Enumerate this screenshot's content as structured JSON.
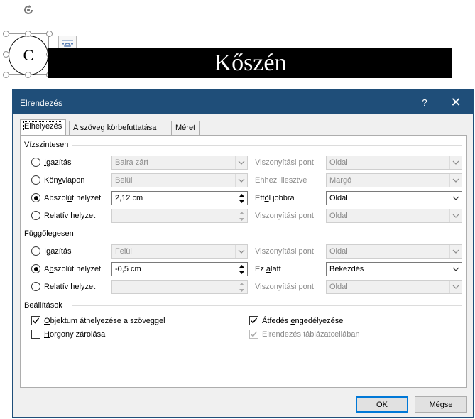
{
  "document": {
    "circle_letter": "C",
    "banner_text": "Kőszén"
  },
  "dialog": {
    "title": "Elrendezés",
    "help_label": "?",
    "close_label": "✕",
    "tabs": [
      {
        "label": "Elhelyezés",
        "active": true
      },
      {
        "label": "A szöveg körbefuttatása",
        "active": false
      },
      {
        "label": "Méret",
        "active": false
      }
    ],
    "horizontal": {
      "heading": "Vízszintesen",
      "rows": [
        {
          "option_pre": "",
          "option_u": "I",
          "option_post": "gazítás",
          "checked": false,
          "value": "Balra zárt",
          "rel_label": "Viszonyítási pont",
          "rel_value": "Oldal",
          "enabled": false
        },
        {
          "option_pre": "Kön",
          "option_u": "y",
          "option_post": "vlapon",
          "checked": false,
          "value": "Belül",
          "rel_label": "Ehhez illesztve",
          "rel_value": "Margó",
          "enabled": false
        },
        {
          "option_pre": "Abszol",
          "option_u": "ú",
          "option_post": "t helyzet",
          "checked": true,
          "value": "2,12 cm",
          "rel_label_pre": "Ett",
          "rel_label_u": "ő",
          "rel_label_post": "l jobbra",
          "rel_value": "Oldal",
          "enabled": true
        },
        {
          "option_pre": "",
          "option_u": "R",
          "option_post": "elatív helyzet",
          "checked": false,
          "value": "",
          "rel_label": "Viszonyítási pont",
          "rel_value": "Oldal",
          "enabled": false
        }
      ]
    },
    "vertical": {
      "heading": "Függőlegesen",
      "rows": [
        {
          "option_pre": "I",
          "option_u": "g",
          "option_post": "azítás",
          "checked": false,
          "value": "Felül",
          "rel_label": "Viszonyítási pont",
          "rel_value": "Oldal",
          "enabled": false
        },
        {
          "option_pre": "A",
          "option_u": "b",
          "option_post": "szolút helyzet",
          "checked": true,
          "value": "-0,5 cm",
          "rel_label_pre": "Ez ",
          "rel_label_u": "a",
          "rel_label_post": "latt",
          "rel_value": "Bekezdés",
          "enabled": true
        },
        {
          "option_pre": "Relat",
          "option_u": "í",
          "option_post": "v helyzet",
          "checked": false,
          "value": "",
          "rel_label": "Viszonyítási pont",
          "rel_value": "Oldal",
          "enabled": false
        }
      ]
    },
    "settings": {
      "heading": "Beállítások",
      "move_with_text": {
        "pre": "",
        "u": "O",
        "post": "bjektum áthelyezése a szöveggel",
        "checked": true
      },
      "lock_anchor": {
        "pre": "",
        "u": "H",
        "post": "orgony zárolása",
        "checked": false
      },
      "allow_overlap": {
        "pre": "Átfedés ",
        "u": "e",
        "post": "ngedélyezése",
        "checked": true
      },
      "layout_in_cell": {
        "label": "Elrendezés táblázatcellában",
        "checked": true,
        "enabled": false
      }
    },
    "ok_label": "OK",
    "cancel_label": "Mégse"
  },
  "icons": {
    "rotate": "rotate-icon",
    "layout_options": "layout-options-icon",
    "dropdown": "chevron-down-icon",
    "spin_up": "spin-up-icon",
    "spin_down": "spin-down-icon",
    "check": "checkmark-icon"
  },
  "colors": {
    "titlebar": "#1f4e79",
    "dialog_bg": "#f0f0f0",
    "focus_border": "#0078d7",
    "banner": "#000000"
  }
}
